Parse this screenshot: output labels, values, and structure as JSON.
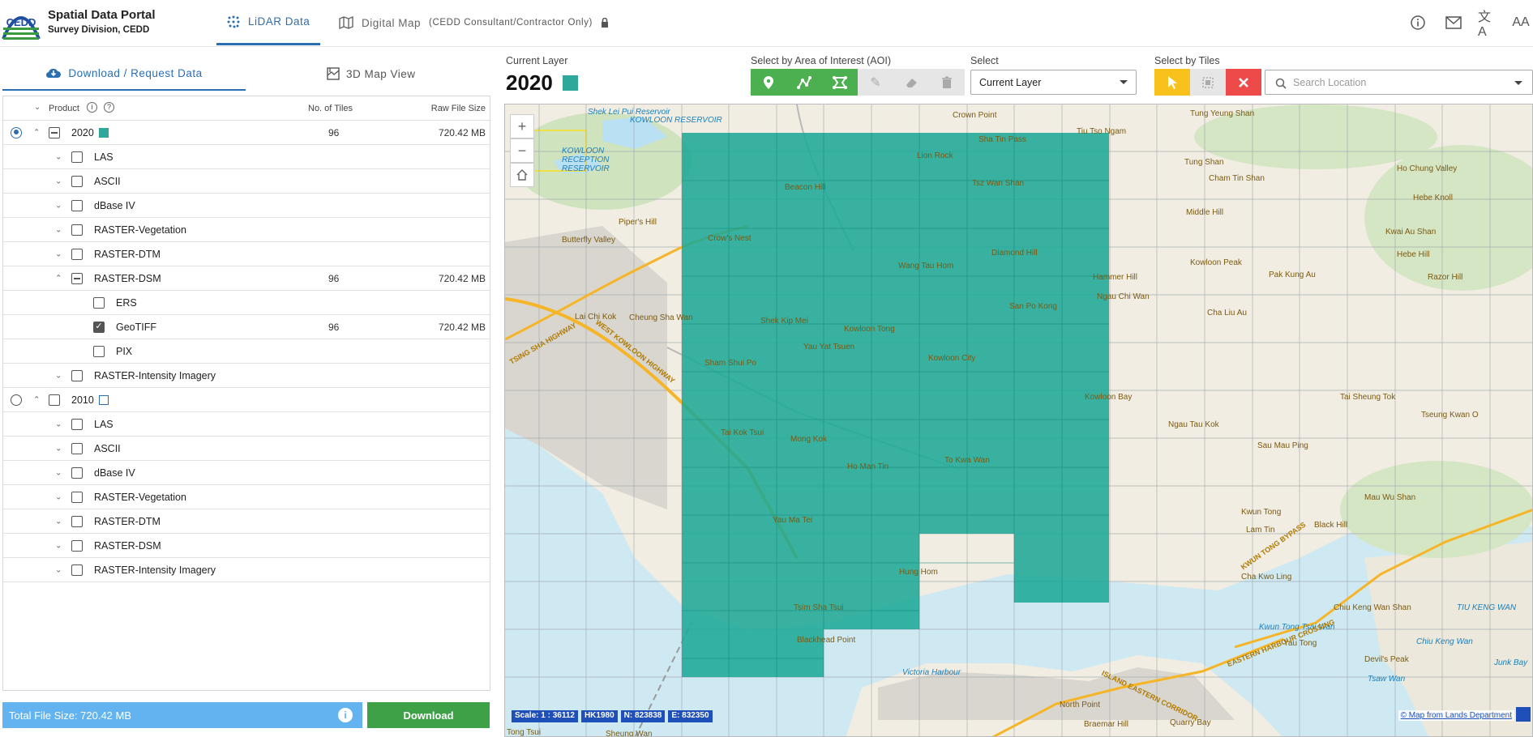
{
  "header": {
    "title": "Spatial Data Portal",
    "subtitle": "Survey Division, CEDD",
    "logo_text": "CEDD",
    "tabs": [
      {
        "label": "LiDAR Data",
        "icon": "scatter-dots-icon",
        "active": true
      },
      {
        "label": "Digital Map",
        "note": "(CEDD Consultant/Contractor Only)",
        "icon": "map-icon",
        "active": false
      }
    ],
    "icons": [
      "info-icon",
      "mail-icon",
      "translate-icon",
      "font-size-icon"
    ]
  },
  "left": {
    "subtabs": [
      {
        "label": "Download / Request Data",
        "icon": "cloud-download-icon",
        "active": true
      },
      {
        "label": "3D Map View",
        "icon": "3d-map-icon",
        "active": false
      }
    ],
    "columns": {
      "product": "Product",
      "tiles": "No. of Tiles",
      "size": "Raw File Size"
    },
    "groups": [
      {
        "year": "2020",
        "selected": true,
        "tiles": "96",
        "size": "720.42 MB",
        "color": "#2fa79a",
        "items": [
          {
            "label": "LAS"
          },
          {
            "label": "ASCII"
          },
          {
            "label": "dBase IV"
          },
          {
            "label": "RASTER-Vegetation"
          },
          {
            "label": "RASTER-DTM"
          },
          {
            "label": "RASTER-DSM",
            "tiles": "96",
            "size": "720.42 MB",
            "expanded": true,
            "children": [
              {
                "label": "ERS"
              },
              {
                "label": "GeoTIFF",
                "tiles": "96",
                "size": "720.42 MB",
                "checked": true
              },
              {
                "label": "PIX"
              }
            ]
          },
          {
            "label": "RASTER-Intensity Imagery"
          }
        ]
      },
      {
        "year": "2010",
        "selected": false,
        "color": "#ffffff",
        "items": [
          {
            "label": "LAS"
          },
          {
            "label": "ASCII"
          },
          {
            "label": "dBase IV"
          },
          {
            "label": "RASTER-Vegetation"
          },
          {
            "label": "RASTER-DTM"
          },
          {
            "label": "RASTER-DSM"
          },
          {
            "label": "RASTER-Intensity Imagery"
          }
        ]
      }
    ],
    "total": "Total File Size: 720.42 MB",
    "download_label": "Download"
  },
  "toolbar": {
    "current_layer_label": "Current Layer",
    "current_layer_value": "2020",
    "current_layer_color": "#2fa79a",
    "aoi_label": "Select by Area of Interest (AOI)",
    "select_label": "Select",
    "select_value": "Current Layer",
    "tiles_label": "Select by Tiles",
    "search_placeholder": "Search Location"
  },
  "map": {
    "labels": [
      {
        "text": "Shek Lei Pui Reservoir",
        "water": true
      },
      {
        "text": "KOWLOON RESERVOIR",
        "water": true
      },
      {
        "text": "KOWLOON RECEPTION RESERVOIR",
        "water": true
      },
      {
        "text": "Crown Point"
      },
      {
        "text": "Tiu Tso Ngam"
      },
      {
        "text": "Tung Yeung Shan"
      },
      {
        "text": "Sha Tin Pass"
      },
      {
        "text": "Lion Rock"
      },
      {
        "text": "Beacon Hill"
      },
      {
        "text": "Tsz Wan Shan"
      },
      {
        "text": "Tung Shan"
      },
      {
        "text": "Cham Tin Shan"
      },
      {
        "text": "Ho Chung Valley"
      },
      {
        "text": "Middle Hill"
      },
      {
        "text": "Hebe Knoll"
      },
      {
        "text": "Piper's Hill"
      },
      {
        "text": "Crow's Nest"
      },
      {
        "text": "Butterfly Valley"
      },
      {
        "text": "Wang Tau Hom"
      },
      {
        "text": "Diamond Hill"
      },
      {
        "text": "Hammer Hill"
      },
      {
        "text": "Kwai Au Shan"
      },
      {
        "text": "Hebe Hill"
      },
      {
        "text": "Kowloon Peak"
      },
      {
        "text": "Pak Kung Au"
      },
      {
        "text": "Razor Hill"
      },
      {
        "text": "Ngau Chi Wan"
      },
      {
        "text": "Lai Chi Kok"
      },
      {
        "text": "Cheung Sha Wan"
      },
      {
        "text": "Shek Kip Mei"
      },
      {
        "text": "Kowloon Tong"
      },
      {
        "text": "San Po Kong"
      },
      {
        "text": "Cha Liu Au"
      },
      {
        "text": "Yau Yat Tsuen"
      },
      {
        "text": "Sham Shui Po"
      },
      {
        "text": "Kowloon City"
      },
      {
        "text": "Kowloon Bay"
      },
      {
        "text": "Tai Sheung Tok"
      },
      {
        "text": "Ngau Tau Kok"
      },
      {
        "text": "Tseung Kwan O"
      },
      {
        "text": "Tai Kok Tsui"
      },
      {
        "text": "Mong Kok"
      },
      {
        "text": "To Kwa Wan"
      },
      {
        "text": "Sau Mau Ping"
      },
      {
        "text": "Ho Man Tin"
      },
      {
        "text": "Mau Wu Shan"
      },
      {
        "text": "Kwun Tong"
      },
      {
        "text": "Yau Ma Tei"
      },
      {
        "text": "Lam Tin"
      },
      {
        "text": "Black Hill"
      },
      {
        "text": "Hung Hom"
      },
      {
        "text": "Cha Kwo Ling"
      },
      {
        "text": "Tsim Sha Tsui"
      },
      {
        "text": "Chiu Keng Wan Shan"
      },
      {
        "text": "TIU KENG WAN",
        "water": true
      },
      {
        "text": "Kwun Tong Tsai Wan",
        "water": true
      },
      {
        "text": "Yau Tong"
      },
      {
        "text": "Chiu Keng Wan",
        "water": true
      },
      {
        "text": "Blackhead Point"
      },
      {
        "text": "Devil's Peak"
      },
      {
        "text": "Junk Bay",
        "water": true
      },
      {
        "text": "Victoria Harbour",
        "water": true
      },
      {
        "text": "Tsaw Wan",
        "water": true
      },
      {
        "text": "North Point"
      },
      {
        "text": "Quarry Bay"
      },
      {
        "text": "Braemar Hill"
      },
      {
        "text": "WEST KOWLOON HIGHWAY"
      },
      {
        "text": "TSING SHA HIGHWAY"
      },
      {
        "text": "ISLAND EASTERN CORRIDOR"
      },
      {
        "text": "EASTERN HARBOUR CROSSING"
      },
      {
        "text": "KWUN TONG BYPASS"
      }
    ],
    "scale": "Scale: 1 : 36112",
    "datum": "HK1980",
    "northing": "N: 823838",
    "easting": "E: 832350",
    "attribution": "© Map from Lands Department",
    "partial_bottom": "Tong Tsui",
    "partial_bottom2": "Sheung Wan",
    "coverage_color": "#1ea896"
  }
}
